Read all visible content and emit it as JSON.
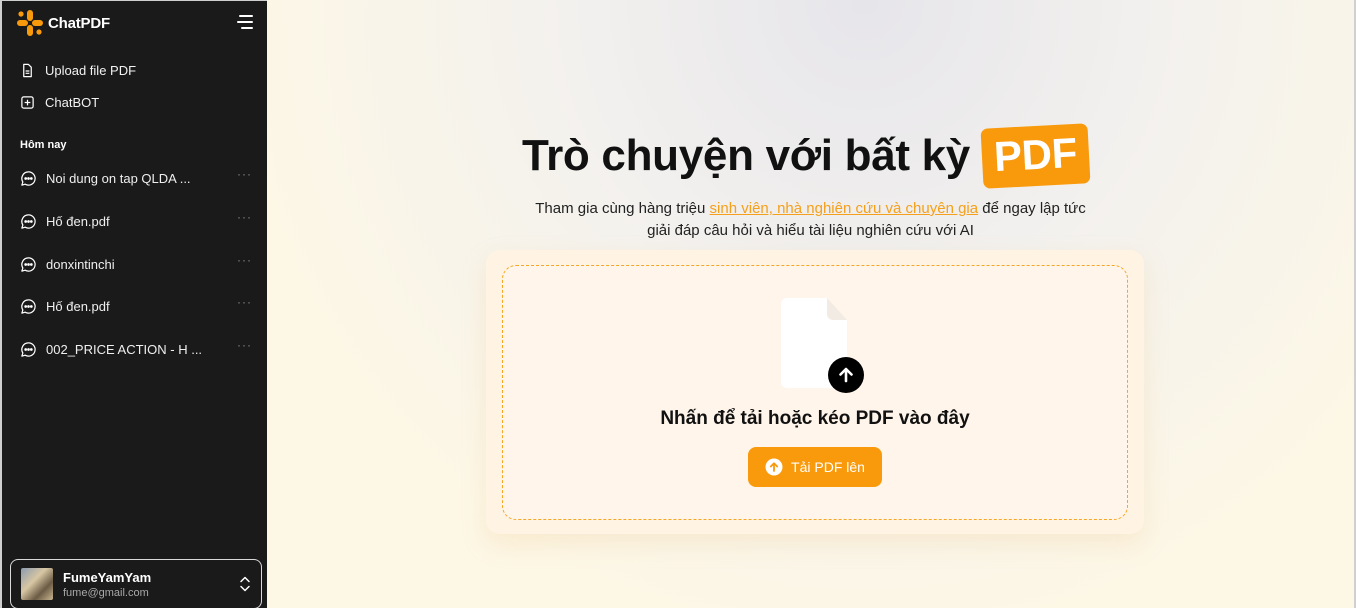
{
  "sidebar": {
    "brand": "ChatPDF",
    "nav": [
      {
        "label": "Upload file PDF",
        "icon": "file-icon"
      },
      {
        "label": "ChatBOT",
        "icon": "plus-square-icon"
      }
    ],
    "section_title": "Hôm nay",
    "chats": [
      {
        "label": "Noi dung on tap QLDA ..."
      },
      {
        "label": "Hố đen.pdf"
      },
      {
        "label": "donxintinchi"
      },
      {
        "label": "Hố đen.pdf"
      },
      {
        "label": "002_PRICE ACTION - H ..."
      }
    ],
    "more_glyph": "···",
    "user": {
      "name": "FumeYamYam",
      "email": "fume@gmail.com"
    }
  },
  "main": {
    "title": "Trò chuyện với bất kỳ",
    "title_badge": "PDF",
    "subtitle_pre": "Tham gia cùng hàng triệu ",
    "subtitle_link": "sinh viên, nhà nghiên cứu và chuyên gia",
    "subtitle_post": " để ngay lập tức",
    "subtitle_line2": "giải đáp câu hỏi và hiểu tài liệu nghiên cứu với AI",
    "drop_text": "Nhấn để tải hoặc kéo PDF vào đây",
    "upload_button": "Tải PDF lên"
  },
  "colors": {
    "accent": "#f99a0c",
    "sidebar_bg": "#1a1a1a",
    "link": "#f5a01a"
  }
}
